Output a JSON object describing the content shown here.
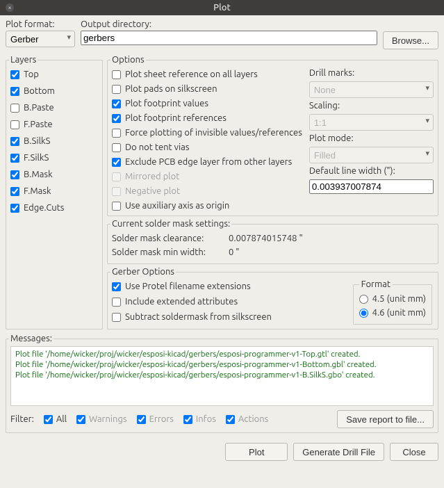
{
  "title": "Plot",
  "top": {
    "format_label": "Plot format:",
    "format_value": "Gerber",
    "dir_label": "Output directory:",
    "dir_value": "gerbers",
    "browse": "Browse..."
  },
  "layers": {
    "legend": "Layers",
    "items": [
      {
        "label": "Top",
        "checked": true
      },
      {
        "label": "Bottom",
        "checked": true
      },
      {
        "label": "B.Paste",
        "checked": false
      },
      {
        "label": "F.Paste",
        "checked": false
      },
      {
        "label": "B.SilkS",
        "checked": true
      },
      {
        "label": "F.SilkS",
        "checked": true
      },
      {
        "label": "B.Mask",
        "checked": true
      },
      {
        "label": "F.Mask",
        "checked": true
      },
      {
        "label": "Edge.Cuts",
        "checked": true
      }
    ]
  },
  "options": {
    "legend": "Options",
    "checks": [
      {
        "label": "Plot sheet reference on all layers",
        "checked": false,
        "disabled": false
      },
      {
        "label": "Plot pads on silkscreen",
        "checked": false,
        "disabled": false
      },
      {
        "label": "Plot footprint values",
        "checked": true,
        "disabled": false
      },
      {
        "label": "Plot footprint references",
        "checked": true,
        "disabled": false
      },
      {
        "label": "Force plotting of invisible values/references",
        "checked": false,
        "disabled": false
      },
      {
        "label": "Do not tent vias",
        "checked": false,
        "disabled": false
      },
      {
        "label": "Exclude PCB edge layer from other layers",
        "checked": true,
        "disabled": false
      },
      {
        "label": "Mirrored plot",
        "checked": false,
        "disabled": true
      },
      {
        "label": "Negative plot",
        "checked": false,
        "disabled": true
      },
      {
        "label": "Use auxiliary axis as origin",
        "checked": false,
        "disabled": false
      }
    ],
    "right": {
      "drill_label": "Drill marks:",
      "drill_value": "None",
      "scaling_label": "Scaling:",
      "scaling_value": "1:1",
      "mode_label": "Plot mode:",
      "mode_value": "Filled",
      "linew_label": "Default line width (\"):",
      "linew_value": "0.003937007874"
    }
  },
  "mask": {
    "legend": "Current solder mask settings:",
    "rows": [
      {
        "k": "Solder mask clearance:",
        "v": "0.007874015748 \""
      },
      {
        "k": "Solder mask min width:",
        "v": "0 \""
      }
    ]
  },
  "gerber": {
    "legend": "Gerber Options",
    "checks": [
      {
        "label": "Use Protel filename extensions",
        "checked": true
      },
      {
        "label": "Include extended attributes",
        "checked": false
      },
      {
        "label": "Subtract soldermask from silkscreen",
        "checked": false
      }
    ],
    "format": {
      "legend": "Format",
      "options": [
        {
          "label": "4.5 (unit mm)",
          "checked": false
        },
        {
          "label": "4.6 (unit mm)",
          "checked": true
        }
      ]
    }
  },
  "messages": {
    "legend": "Messages:",
    "lines": [
      "Plot file '/home/wicker/proj/wicker/esposi-kicad/gerbers/esposi-programmer-v1-Top.gtl' created.",
      "Plot file '/home/wicker/proj/wicker/esposi-kicad/gerbers/esposi-programmer-v1-Bottom.gbl' created.",
      "Plot file '/home/wicker/proj/wicker/esposi-kicad/gerbers/esposi-programmer-v1-B.SilkS.gbo' created."
    ],
    "filter_label": "Filter:",
    "filters": [
      {
        "label": "All",
        "checked": true,
        "dim": false
      },
      {
        "label": "Warnings",
        "checked": true,
        "dim": true
      },
      {
        "label": "Errors",
        "checked": true,
        "dim": true
      },
      {
        "label": "Infos",
        "checked": true,
        "dim": true
      },
      {
        "label": "Actions",
        "checked": true,
        "dim": true
      }
    ],
    "save": "Save report to file..."
  },
  "buttons": {
    "plot": "Plot",
    "drill": "Generate Drill File",
    "close": "Close"
  }
}
